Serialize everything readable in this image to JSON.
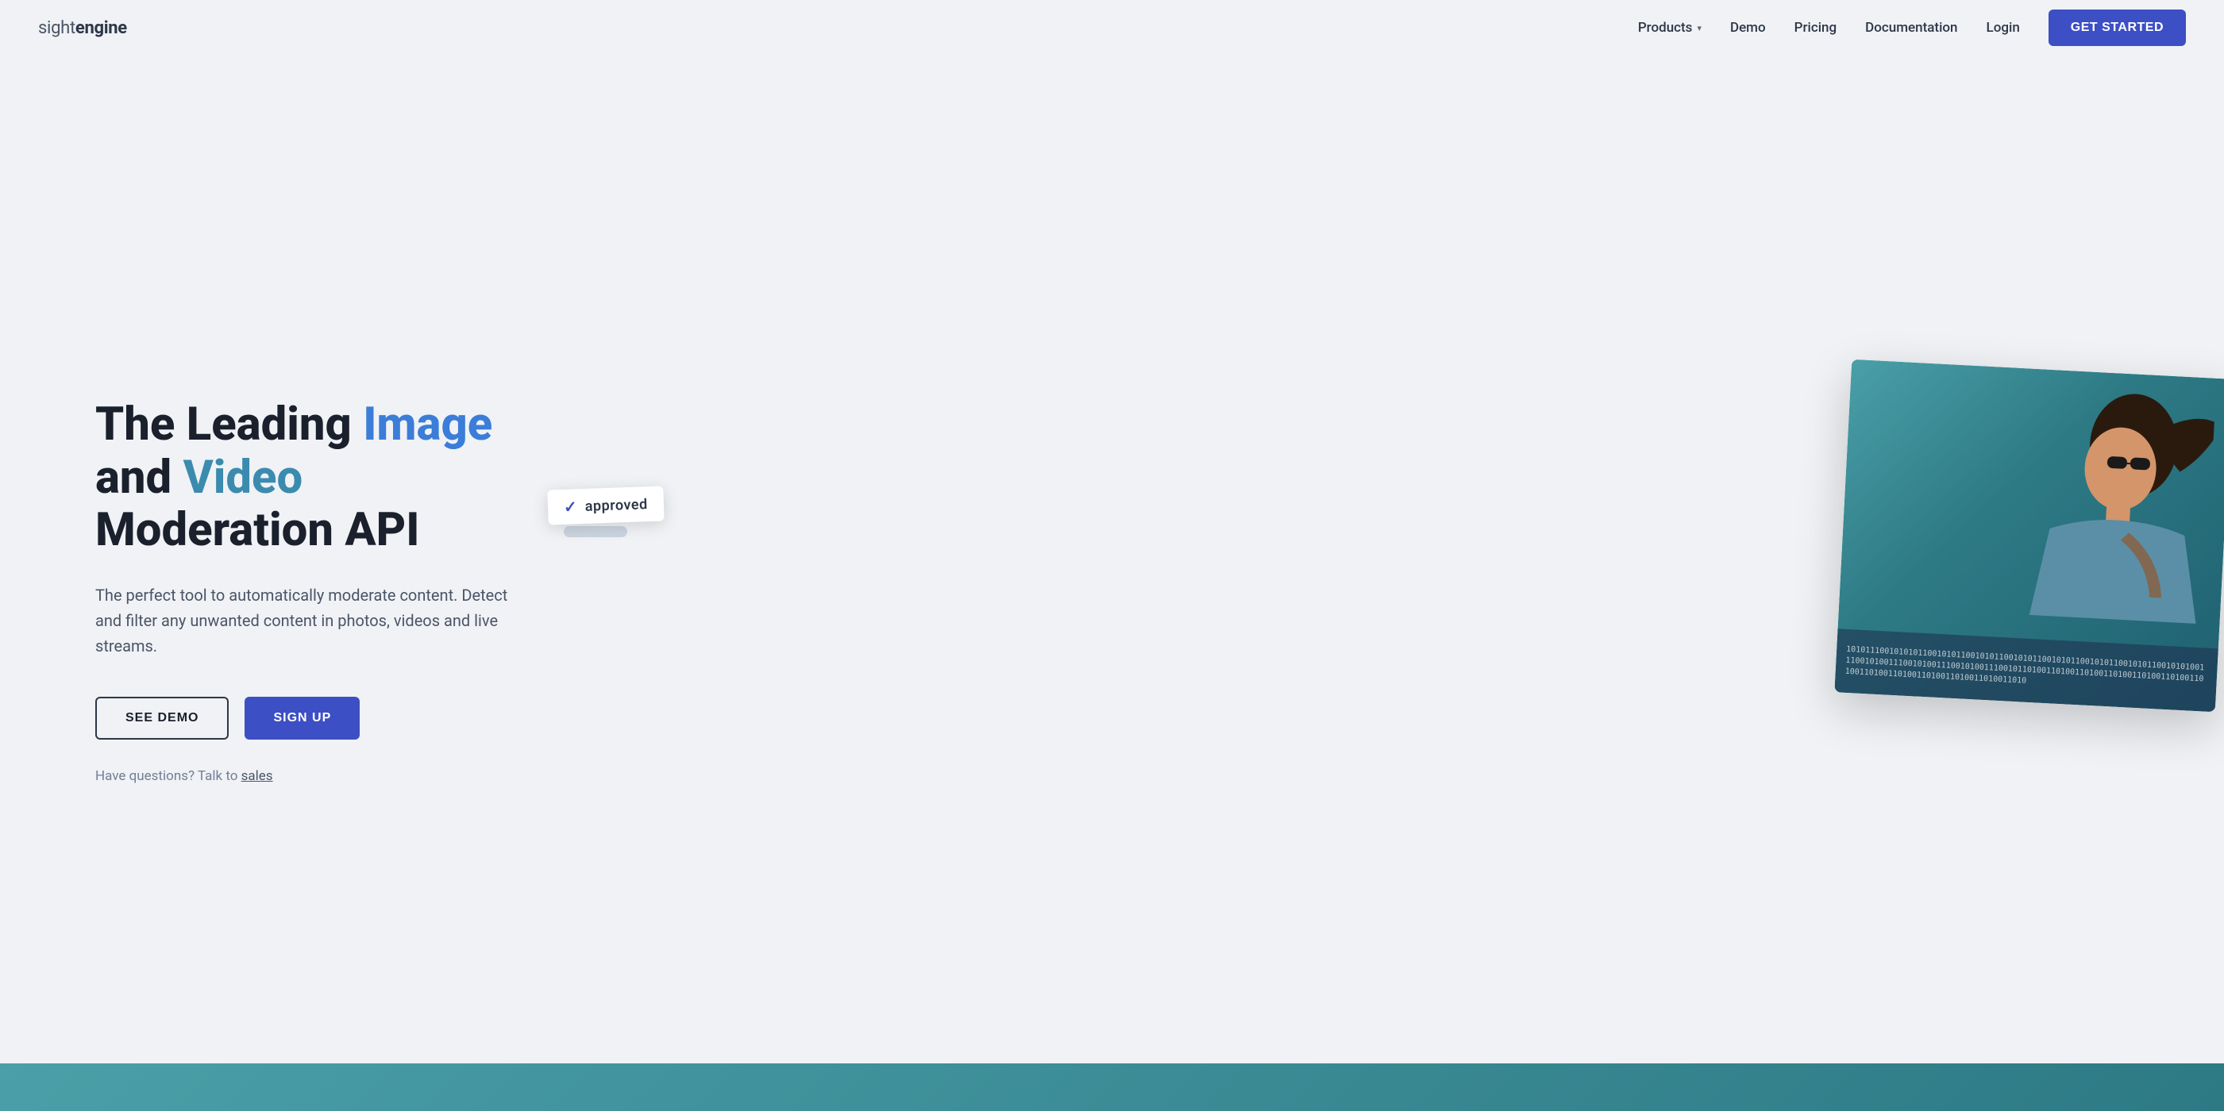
{
  "logo": {
    "sight": "sight",
    "engine": "engine"
  },
  "nav": {
    "products_label": "Products",
    "demo_label": "Demo",
    "pricing_label": "Pricing",
    "documentation_label": "Documentation",
    "login_label": "Login",
    "get_started_label": "GET STARTED"
  },
  "hero": {
    "title_part1": "The Leading ",
    "title_image": "Image",
    "title_part2": " and ",
    "title_video": "Video",
    "title_part3": " Moderation API",
    "subtitle": "The perfect tool to automatically moderate content. Detect and filter any unwanted content in photos, videos and live streams.",
    "btn_demo": "SEE DEMO",
    "btn_signup": "SIGN UP",
    "sales_text": "Have questions? Talk to ",
    "sales_link": "sales"
  },
  "badge": {
    "approved": "approved"
  },
  "binary": "10101110010101011001010110010101100101011001010110010101100101011001010100111001010011100101001110010100111001011010011010011010011010011010011010011010011010011010011010011010011010011010"
}
